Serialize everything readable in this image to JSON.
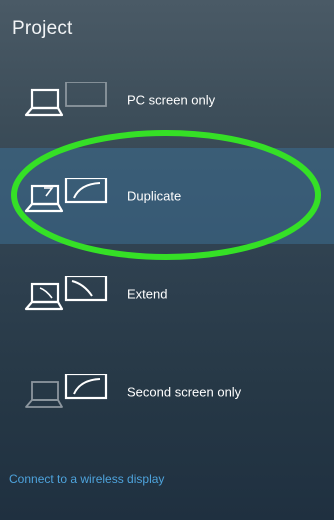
{
  "panel": {
    "title": "Project"
  },
  "options": [
    {
      "label": "PC screen only",
      "icon": "pc-screen-only-icon",
      "selected": false
    },
    {
      "label": "Duplicate",
      "icon": "duplicate-icon",
      "selected": true
    },
    {
      "label": "Extend",
      "icon": "extend-icon",
      "selected": false
    },
    {
      "label": "Second screen only",
      "icon": "second-screen-only-icon",
      "selected": false
    }
  ],
  "footer": {
    "link_label": "Connect to a wireless display"
  },
  "colors": {
    "link": "#4ea3dc",
    "highlight_ring": "#35e026",
    "selected_bg": "#3c6e91"
  }
}
